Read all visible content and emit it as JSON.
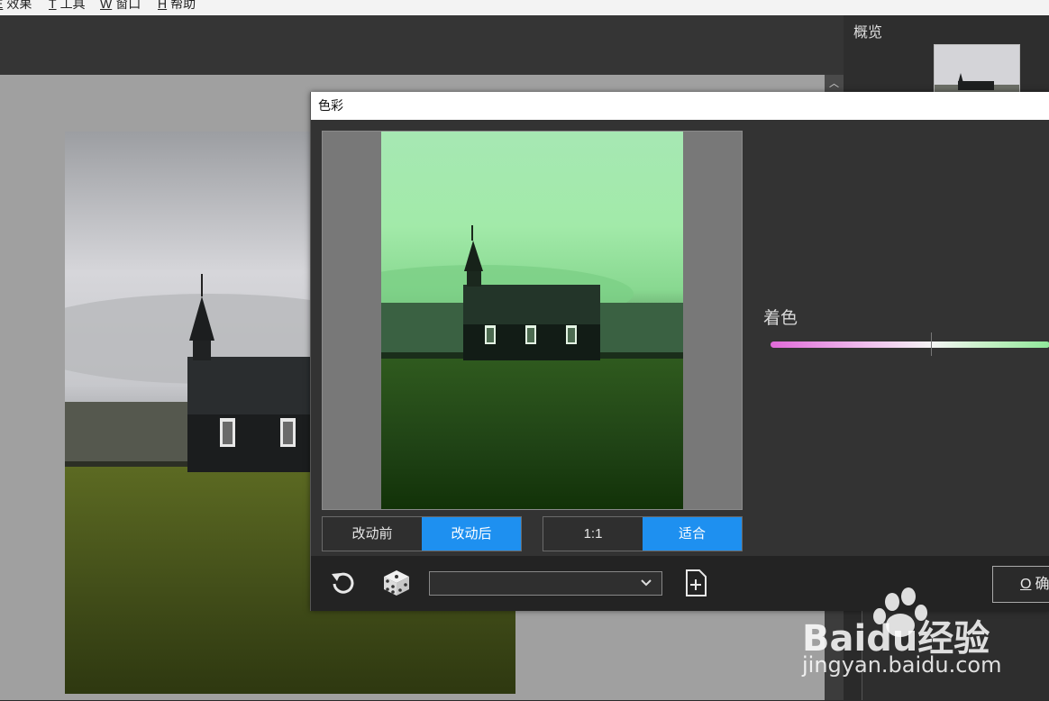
{
  "menu": {
    "items": [
      {
        "key": "E",
        "label": "效果"
      },
      {
        "key": "T",
        "label": "工具"
      },
      {
        "key": "W",
        "label": "窗口"
      },
      {
        "key": "H",
        "label": "帮助"
      }
    ]
  },
  "overview_panel": {
    "title": "概览"
  },
  "dialog": {
    "title": "色彩",
    "compare": {
      "before_label": "改动前",
      "after_label": "改动后",
      "active": "after"
    },
    "zoom": {
      "actual_label": "1:1",
      "fit_label": "适合",
      "active": "fit"
    },
    "tint": {
      "label": "着色",
      "value": 0.58
    },
    "preset_select": {
      "value": ""
    },
    "ok_button": {
      "key": "O",
      "label": "确"
    }
  },
  "watermark": {
    "brand": "Baidu经验",
    "url": "jingyan.baidu.com"
  },
  "colors": {
    "accent": "#1e90f0",
    "tint_left": "#e06ad8",
    "tint_right": "#90e89a"
  },
  "icons": [
    "reset-icon",
    "dice-icon",
    "chevron-down-icon",
    "new-preset-icon"
  ]
}
